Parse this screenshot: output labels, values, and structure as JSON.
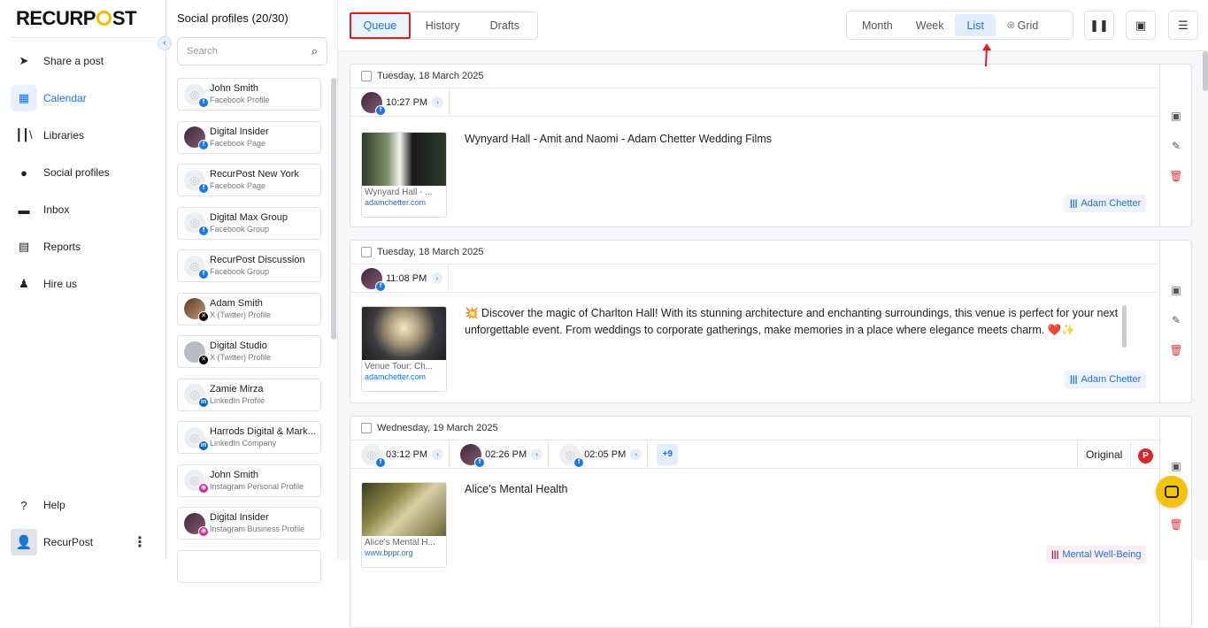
{
  "brand": {
    "logo_text_1": "RECURP",
    "logo_text_2": "ST"
  },
  "nav": {
    "items": [
      {
        "label": "Share a post",
        "icon": "send-icon"
      },
      {
        "label": "Calendar",
        "icon": "calendar-icon",
        "active": true
      },
      {
        "label": "Libraries",
        "icon": "libraries-icon"
      },
      {
        "label": "Social profiles",
        "icon": "user-circle-icon"
      },
      {
        "label": "Inbox",
        "icon": "inbox-icon"
      },
      {
        "label": "Reports",
        "icon": "reports-icon"
      },
      {
        "label": "Hire us",
        "icon": "person-icon"
      }
    ],
    "help": "Help",
    "account": "RecurPost"
  },
  "profiles": {
    "title": "Social profiles (20/30)",
    "search_placeholder": "Search",
    "items": [
      {
        "name": "John Smith",
        "type": "Facebook Profile",
        "network": "fb"
      },
      {
        "name": "Digital Insider",
        "type": "Facebook Page",
        "network": "fb"
      },
      {
        "name": "RecurPost New York",
        "type": "Facebook Page",
        "network": "fb"
      },
      {
        "name": "Digital Max Group",
        "type": "Facebook Group",
        "network": "fb"
      },
      {
        "name": "RecurPost Discussion",
        "type": "Facebook Group",
        "network": "fb"
      },
      {
        "name": "Adam Smith",
        "type": "X (Twitter) Profile",
        "network": "x"
      },
      {
        "name": "Digital Studio",
        "type": "X (Twitter) Profile",
        "network": "x"
      },
      {
        "name": "Zamie Mirza",
        "type": "LinkedIn Profile",
        "network": "li"
      },
      {
        "name": "Harrods Digital & Mark...",
        "type": "LinkedIn Company",
        "network": "li"
      },
      {
        "name": "John Smith",
        "type": "Instagram Personal Profile",
        "network": "ig"
      },
      {
        "name": "Digital Insider",
        "type": "Instagram Business Profile",
        "network": "ig"
      }
    ]
  },
  "toolbar": {
    "tabs": [
      "Queue",
      "History",
      "Drafts"
    ],
    "views": [
      "Month",
      "Week",
      "List",
      "Grid"
    ],
    "active_tab": "Queue",
    "active_view": "List"
  },
  "posts": [
    {
      "date": "Tuesday, 18 March 2025",
      "times": [
        "10:27 PM"
      ],
      "text": "Wynyard Hall - Amit and Naomi - Adam Chetter Wedding Films",
      "thumb_title": "Wynyard Hall - ...",
      "thumb_domain": "adamchetter.com",
      "library": "Adam Chetter"
    },
    {
      "date": "Tuesday, 18 March 2025",
      "times": [
        "11:08 PM"
      ],
      "text": "💥 Discover the magic of Charlton Hall! With its stunning architecture and enchanting surroundings, this venue is perfect for your next unforgettable event. From weddings to corporate gatherings, make memories in a place where elegance meets charm. ❤️✨",
      "thumb_title": "Venue Tour: Ch...",
      "thumb_domain": "adamchetter.com",
      "library": "Adam Chetter"
    },
    {
      "date": "Wednesday, 19 March 2025",
      "times": [
        "03:12 PM",
        "02:26 PM",
        "02:05 PM"
      ],
      "more": "+9",
      "original": "Original",
      "text": "Alice’s Mental Health",
      "thumb_title": "Alice’s Mental H...",
      "thumb_domain": "www.bppr.org",
      "library": "Mental Well-Being"
    }
  ]
}
